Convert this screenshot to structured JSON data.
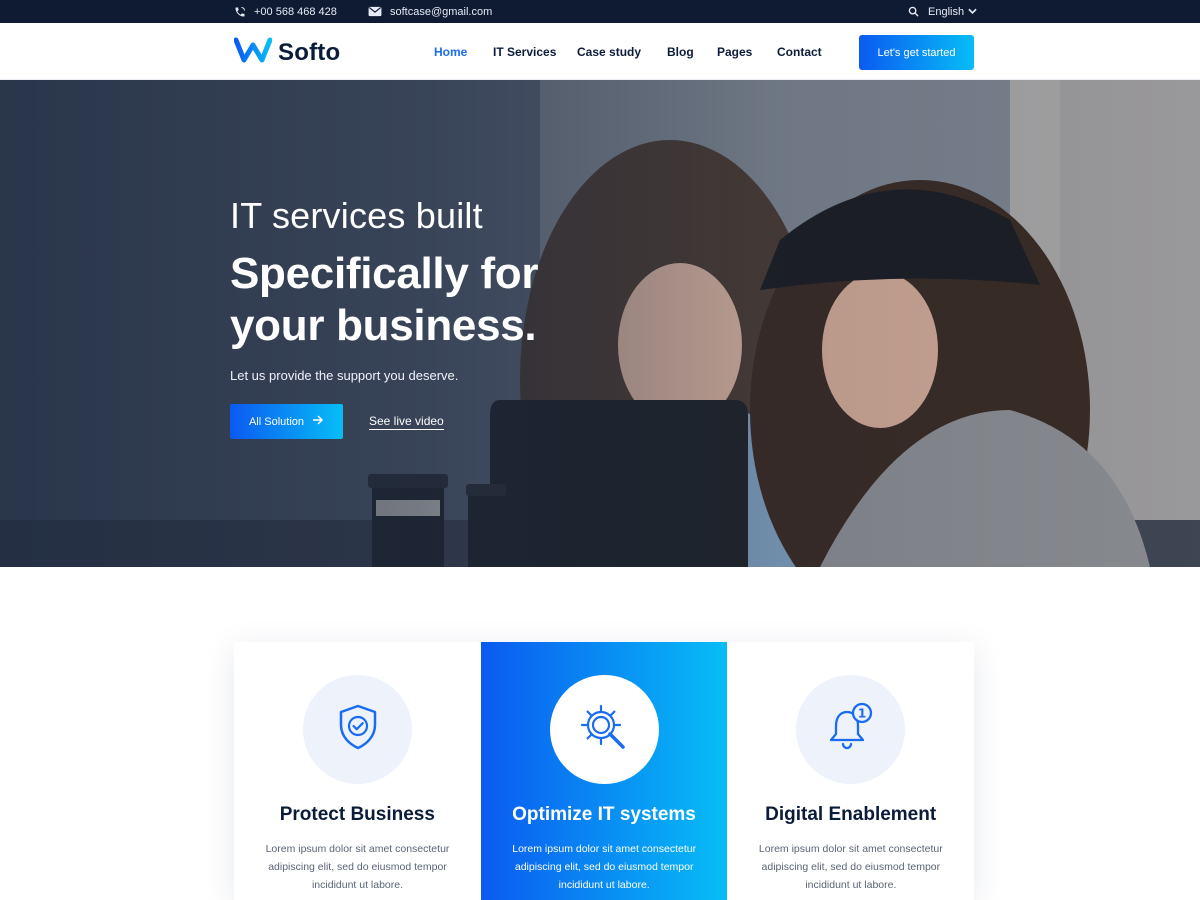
{
  "topbar": {
    "phone": "+00 568 468 428",
    "email": "softcase@gmail.com",
    "language": "English",
    "icons": [
      "phone-icon",
      "mail-icon",
      "search-icon",
      "chevron-down-icon"
    ]
  },
  "header": {
    "logo_text": "Softo",
    "nav": [
      {
        "label": "Home",
        "active": true
      },
      {
        "label": "IT Services",
        "active": false
      },
      {
        "label": "Case study",
        "active": false
      },
      {
        "label": "Blog",
        "active": false
      },
      {
        "label": "Pages",
        "active": false
      },
      {
        "label": "Contact",
        "active": false
      }
    ],
    "cta_label": "Let's get started"
  },
  "hero": {
    "line1": "IT services built",
    "line2a": "Specifically for",
    "line2b": "your business.",
    "subtitle": "Let us provide the support you deserve.",
    "primary_button": "All Solution",
    "secondary_link": "See live video"
  },
  "features": [
    {
      "icon": "shield-check-icon",
      "title": "Protect Business",
      "text": "Lorem ipsum dolor sit amet consectetur adipiscing elit, sed do eiusmod tempor incididunt ut labore."
    },
    {
      "icon": "gear-search-icon",
      "title": "Optimize IT systems",
      "text": "Lorem ipsum dolor sit amet consectetur adipiscing elit, sed do eiusmod tempor incididunt ut labore."
    },
    {
      "icon": "bell-notification-icon",
      "title": "Digital Enablement",
      "text": "Lorem ipsum dolor sit amet consectetur adipiscing elit, sed do eiusmod tempor incididunt ut labore."
    }
  ],
  "colors": {
    "accent_start": "#0b5af0",
    "accent_end": "#07bdf6",
    "topbar_bg": "#0f1b33",
    "heading": "#0b1c39",
    "nav_active": "#1a6cf0"
  }
}
